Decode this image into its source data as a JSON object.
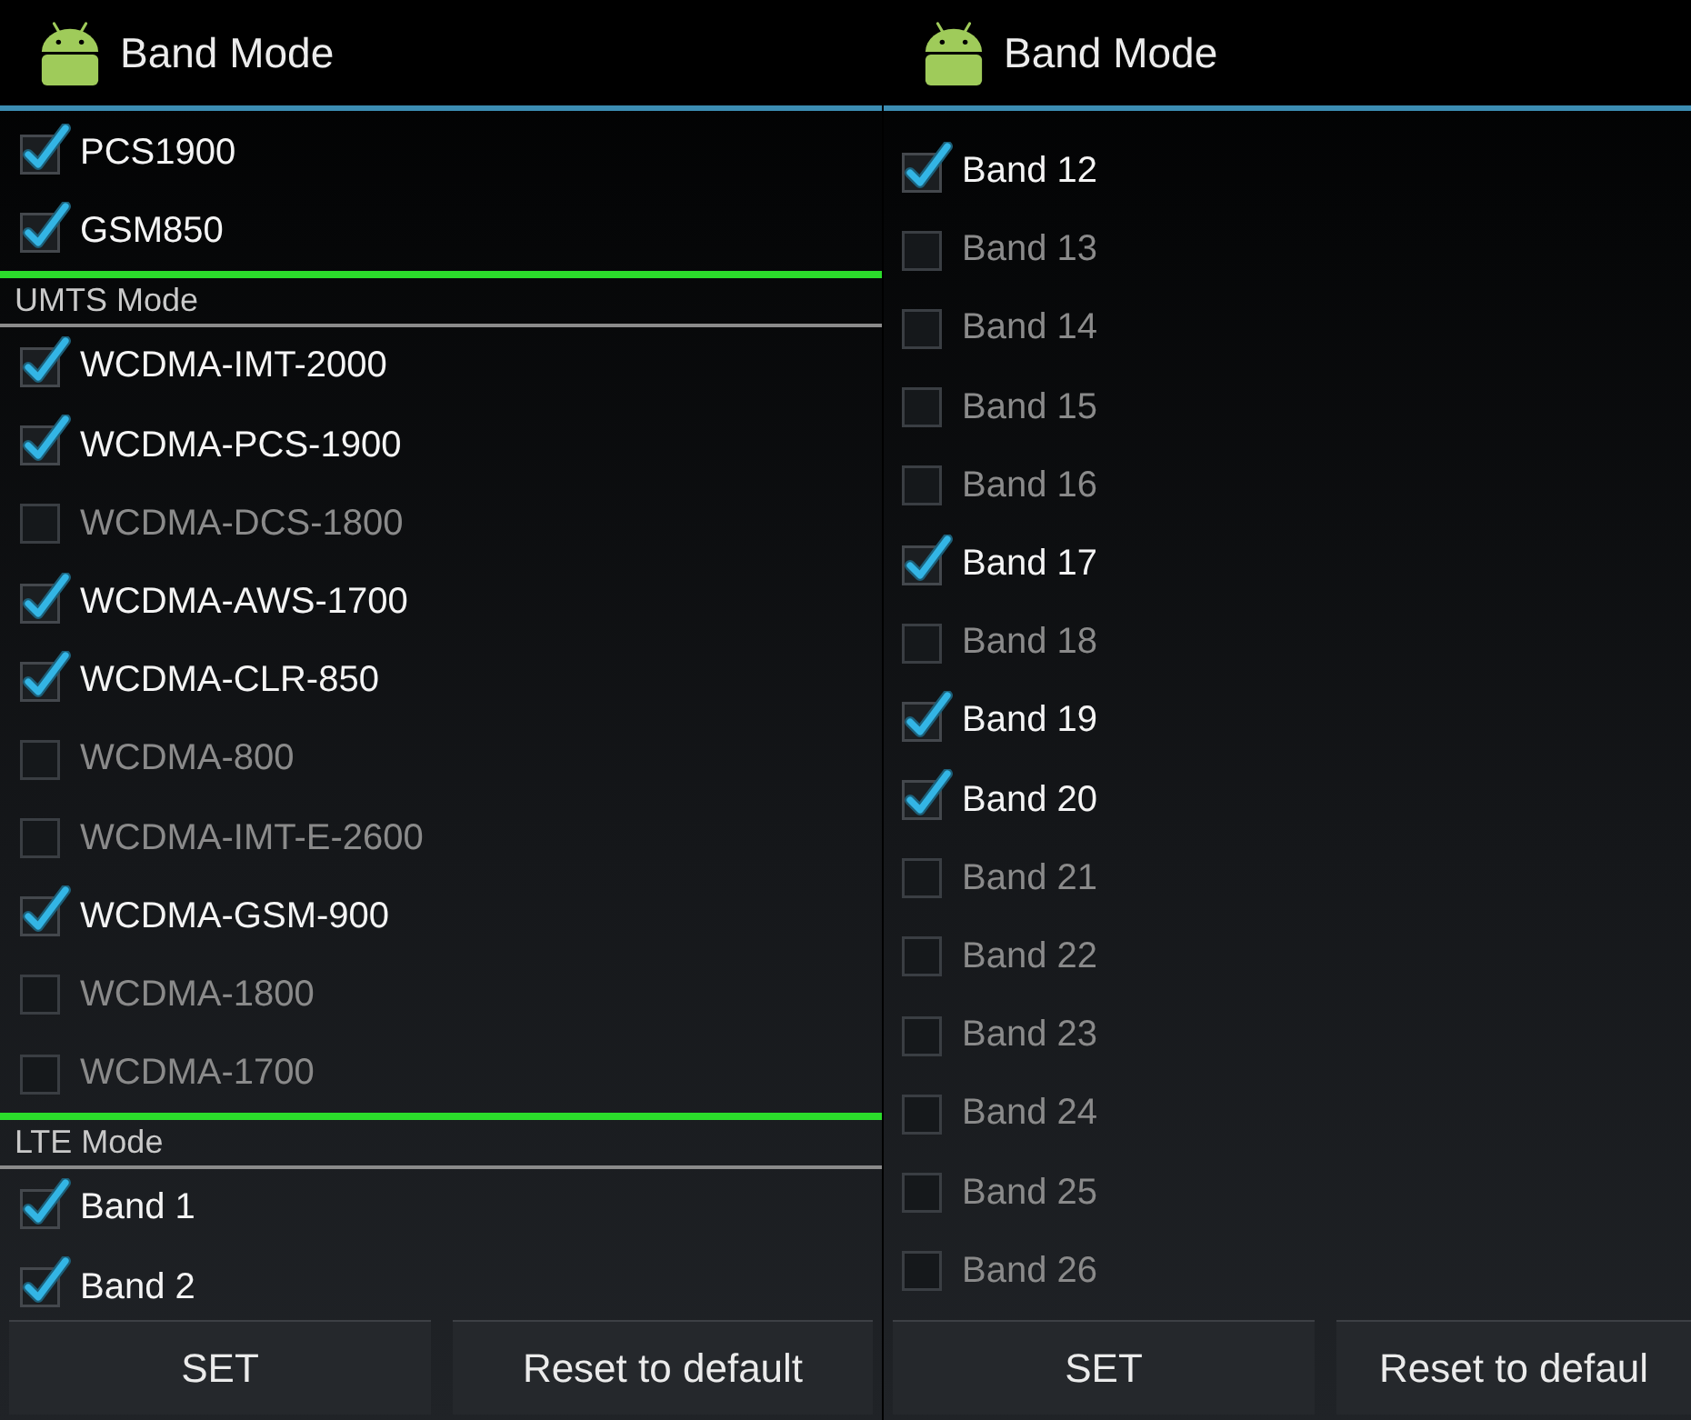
{
  "panels": [
    {
      "title": "Band Mode",
      "items": [
        {
          "kind": "option",
          "label": "PCS1900",
          "checked": true
        },
        {
          "kind": "option",
          "label": "GSM850",
          "checked": true
        },
        {
          "kind": "section",
          "label": "UMTS Mode"
        },
        {
          "kind": "option",
          "label": "WCDMA-IMT-2000",
          "checked": true
        },
        {
          "kind": "option",
          "label": "WCDMA-PCS-1900",
          "checked": true
        },
        {
          "kind": "option",
          "label": "WCDMA-DCS-1800",
          "checked": false
        },
        {
          "kind": "option",
          "label": "WCDMA-AWS-1700",
          "checked": true
        },
        {
          "kind": "option",
          "label": "WCDMA-CLR-850",
          "checked": true
        },
        {
          "kind": "option",
          "label": "WCDMA-800",
          "checked": false
        },
        {
          "kind": "option",
          "label": "WCDMA-IMT-E-2600",
          "checked": false
        },
        {
          "kind": "option",
          "label": "WCDMA-GSM-900",
          "checked": true
        },
        {
          "kind": "option",
          "label": "WCDMA-1800",
          "checked": false
        },
        {
          "kind": "option",
          "label": "WCDMA-1700",
          "checked": false
        },
        {
          "kind": "section",
          "label": "LTE Mode"
        },
        {
          "kind": "option",
          "label": "Band 1",
          "checked": true
        },
        {
          "kind": "option",
          "label": "Band 2",
          "checked": true
        }
      ],
      "buttons": [
        "SET",
        "Reset to default"
      ]
    },
    {
      "title": "Band Mode",
      "items": [
        {
          "kind": "option",
          "label": "Band 12",
          "checked": true
        },
        {
          "kind": "option",
          "label": "Band 13",
          "checked": false
        },
        {
          "kind": "option",
          "label": "Band 14",
          "checked": false
        },
        {
          "kind": "option",
          "label": "Band 15",
          "checked": false
        },
        {
          "kind": "option",
          "label": "Band 16",
          "checked": false
        },
        {
          "kind": "option",
          "label": "Band 17",
          "checked": true
        },
        {
          "kind": "option",
          "label": "Band 18",
          "checked": false
        },
        {
          "kind": "option",
          "label": "Band 19",
          "checked": true
        },
        {
          "kind": "option",
          "label": "Band 20",
          "checked": true
        },
        {
          "kind": "option",
          "label": "Band 21",
          "checked": false
        },
        {
          "kind": "option",
          "label": "Band 22",
          "checked": false
        },
        {
          "kind": "option",
          "label": "Band 23",
          "checked": false
        },
        {
          "kind": "option",
          "label": "Band 24",
          "checked": false
        },
        {
          "kind": "option",
          "label": "Band 25",
          "checked": false
        },
        {
          "kind": "option",
          "label": "Band 26",
          "checked": false
        }
      ],
      "buttons": [
        "SET",
        "Reset to defaul"
      ]
    }
  ]
}
